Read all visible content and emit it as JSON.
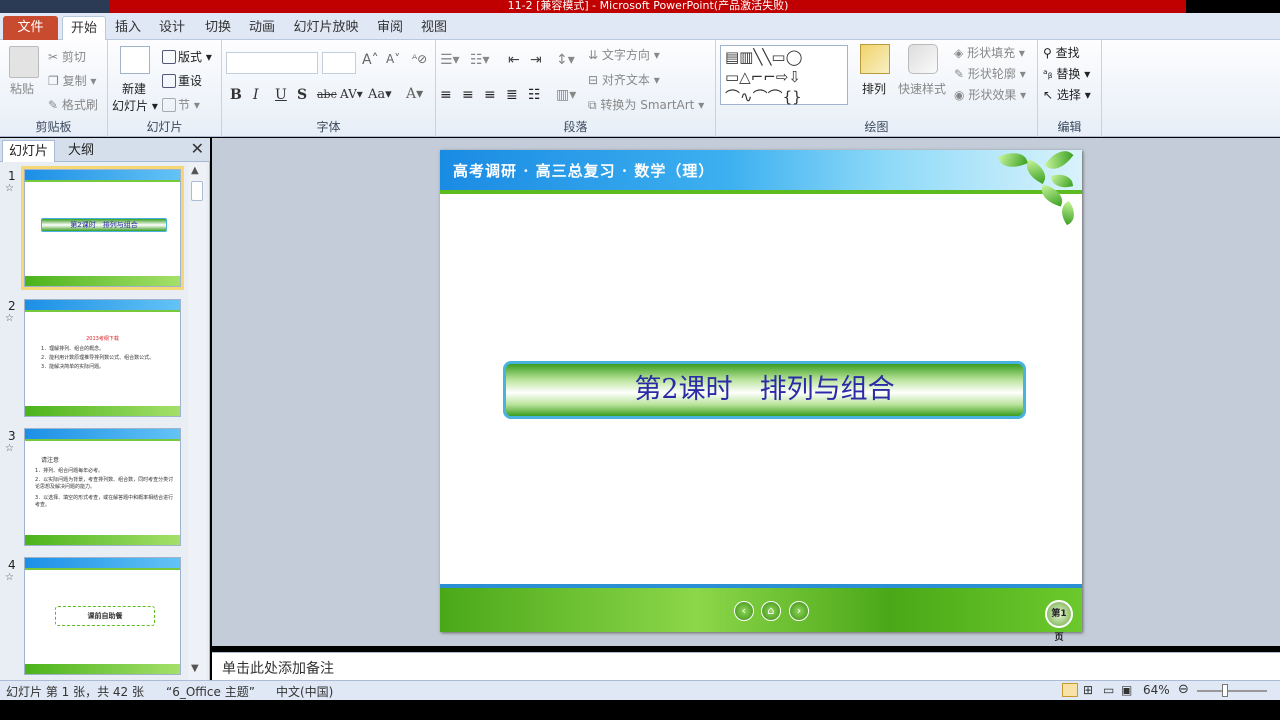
{
  "window": {
    "title": "11-2 [兼容模式] - Microsoft PowerPoint(产品激活失败)"
  },
  "menu": {
    "file": "文件",
    "home": "开始",
    "insert": "插入",
    "design": "设计",
    "transitions": "切换",
    "animations": "动画",
    "slideshow": "幻灯片放映",
    "review": "审阅",
    "view": "视图"
  },
  "ribbon": {
    "clipboard": {
      "label": "剪贴板",
      "paste": "粘贴",
      "cut": "剪切",
      "copy": "复制",
      "format_painter": "格式刷"
    },
    "slides": {
      "label": "幻灯片",
      "new_slide": "新建",
      "new_slide2": "幻灯片",
      "layout": "版式",
      "reset": "重设",
      "section": "节"
    },
    "font": {
      "label": "字体",
      "font_name": "",
      "font_size": ""
    },
    "paragraph": {
      "label": "段落",
      "text_direction": "文字方向",
      "align_text": "对齐文本",
      "smartart": "转换为 SmartArt"
    },
    "drawing": {
      "label": "绘图",
      "arrange": "排列",
      "quick_styles": "快速样式",
      "shape_fill": "形状填充",
      "shape_outline": "形状轮廓",
      "shape_effects": "形状效果"
    },
    "editing": {
      "label": "编辑",
      "find": "查找",
      "replace": "替换",
      "select": "选择"
    }
  },
  "left_pane": {
    "tab_slides": "幻灯片",
    "tab_outline": "大纲",
    "close": "✕"
  },
  "thumbnails": [
    {
      "num": "1",
      "title": "第2课时　排列与组合"
    },
    {
      "num": "2",
      "heading": "2013考纲下载",
      "lines": [
        "1．理解排列、组合的概念。",
        "2．能利用计数原理推导排列数公式、组合数公式。",
        "3．能解决简单的实际问题。"
      ]
    },
    {
      "num": "3",
      "heading": "请注意",
      "lines": [
        "1．排列、组合问题每年必考。",
        "2．以实际问题为背景，考查排列数、组合数，同时考查分类讨论思想及解决问题的能力。",
        "3．以选择、填空的形式考查，或在解答题中和概率相结合进行考查。"
      ]
    },
    {
      "num": "4",
      "title": "课前自助餐"
    }
  ],
  "slide": {
    "header": "高考调研 · 高三总复习 · 数学（理）",
    "title": "第2课时　排列与组合",
    "page_label": "第1页",
    "nav_prev": "‹",
    "nav_home": "⌂",
    "nav_next": "›"
  },
  "notes": {
    "placeholder": "单击此处添加备注"
  },
  "status": {
    "slide_info": "幻灯片 第 1 张，共 42 张",
    "theme": "“6_Office 主题”",
    "language": "中文(中国)",
    "zoom": "64%"
  },
  "colors": {
    "accent": "#c84b2f",
    "slide_header": "#1a8be3",
    "slide_green": "#5cbc1f",
    "title_text": "#2b2ba8"
  }
}
